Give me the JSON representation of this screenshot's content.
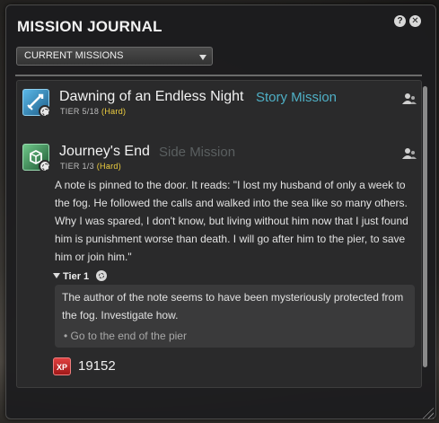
{
  "window": {
    "title": "MISSION JOURNAL",
    "help_button": "?",
    "close_button": "✕"
  },
  "filter": {
    "selected": "CURRENT MISSIONS"
  },
  "missions": [
    {
      "name": "Dawning of an Endless Night",
      "type": "Story Mission",
      "type_color": "#4fb0c6",
      "tier_text": "TIER 5/18",
      "difficulty": "(Hard)",
      "icon_color": "#2f7fb0"
    },
    {
      "name": "Journey's End",
      "type": "Side Mission",
      "type_color": "#5a5f60",
      "tier_text": "TIER 1/3",
      "difficulty": "(Hard)",
      "icon_color": "#2e7d4a"
    }
  ],
  "details": {
    "description": "A note is pinned to the door. It reads: \"I lost my husband of only a week to the fog. He followed the calls and walked into the sea like so many others. Why I was spared, I don't know, but living without him now that I just found him is punishment worse than death. I will go after him to the pier, to save him or join him.\"",
    "tier_label": "Tier 1",
    "tier_description": "The author of the note seems to have been mysteriously protected from the fog. Investigate how.",
    "objective": "Go to the end of the pier",
    "reward_label": "XP",
    "reward_xp": "19152"
  }
}
